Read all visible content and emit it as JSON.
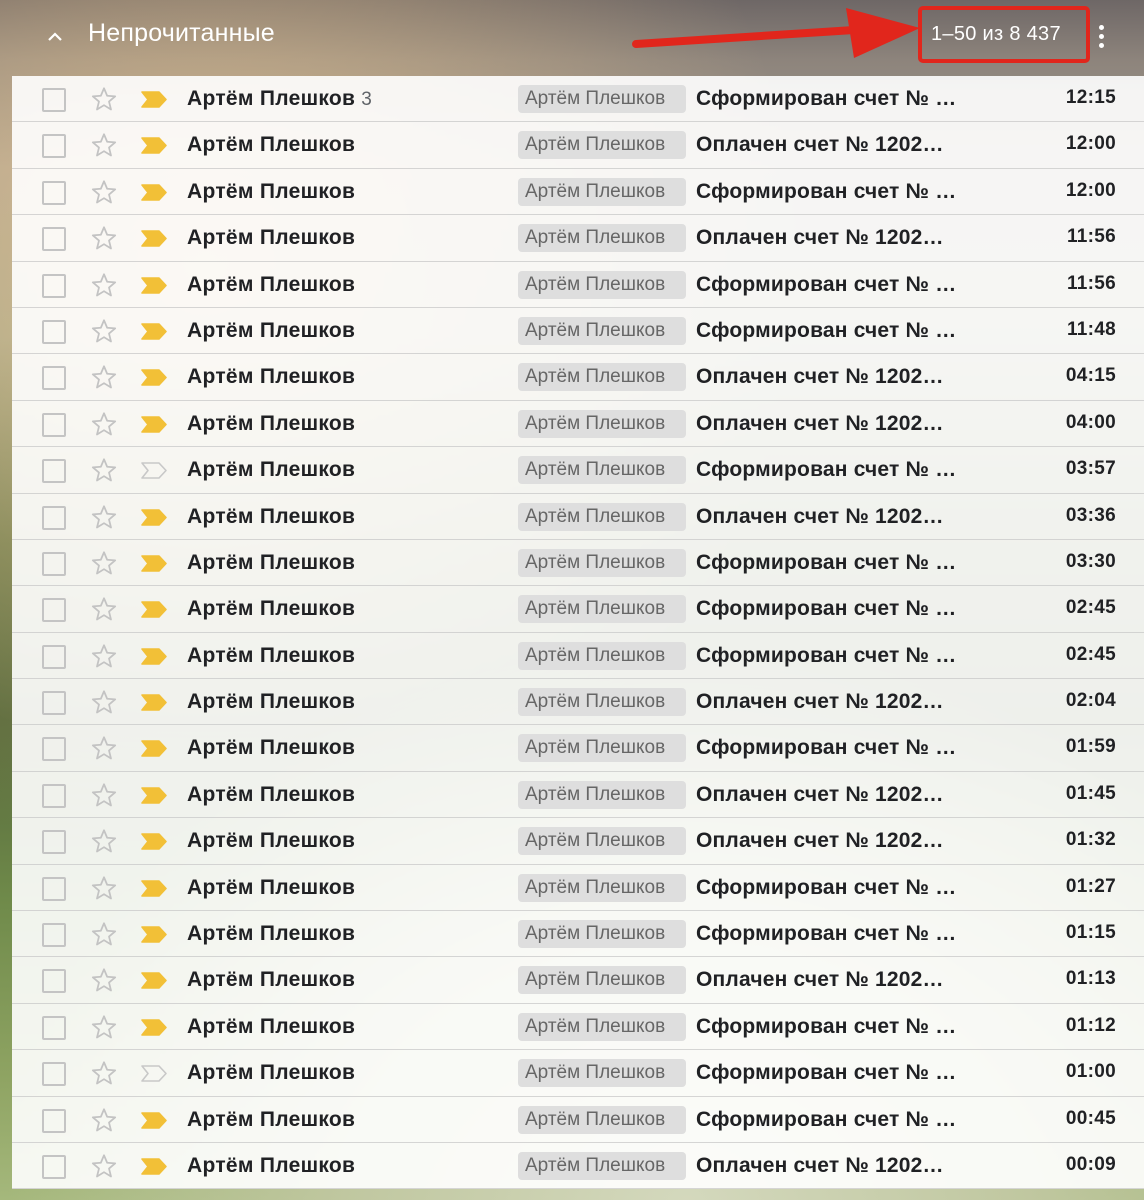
{
  "section": {
    "title": "Непрочитанные",
    "collapse_icon": "chevron-up-icon",
    "more_icon": "more-vert-icon"
  },
  "pagination": {
    "text": "1–50 из 8 437"
  },
  "colors": {
    "highlight": "#e1261c",
    "importance": "#f2c037",
    "importance_outline": "#c8c8c8"
  },
  "rows": [
    {
      "sender": "Артём Плешков",
      "count": "3",
      "label": "Артём Плешков",
      "subject": "Сформирован счет № …",
      "time": "12:15",
      "important": true
    },
    {
      "sender": "Артём Плешков",
      "count": "",
      "label": "Артём Плешков",
      "subject": "Оплачен счет № 1202…",
      "time": "12:00",
      "important": true
    },
    {
      "sender": "Артём Плешков",
      "count": "",
      "label": "Артём Плешков",
      "subject": "Сформирован счет № …",
      "time": "12:00",
      "important": true
    },
    {
      "sender": "Артём Плешков",
      "count": "",
      "label": "Артём Плешков",
      "subject": "Оплачен счет № 1202…",
      "time": "11:56",
      "important": true
    },
    {
      "sender": "Артём Плешков",
      "count": "",
      "label": "Артём Плешков",
      "subject": "Сформирован счет № …",
      "time": "11:56",
      "important": true
    },
    {
      "sender": "Артём Плешков",
      "count": "",
      "label": "Артём Плешков",
      "subject": "Сформирован счет № …",
      "time": "11:48",
      "important": true
    },
    {
      "sender": "Артём Плешков",
      "count": "",
      "label": "Артём Плешков",
      "subject": "Оплачен счет № 1202…",
      "time": "04:15",
      "important": true
    },
    {
      "sender": "Артём Плешков",
      "count": "",
      "label": "Артём Плешков",
      "subject": "Оплачен счет № 1202…",
      "time": "04:00",
      "important": true
    },
    {
      "sender": "Артём Плешков",
      "count": "",
      "label": "Артём Плешков",
      "subject": "Сформирован счет № …",
      "time": "03:57",
      "important": false
    },
    {
      "sender": "Артём Плешков",
      "count": "",
      "label": "Артём Плешков",
      "subject": "Оплачен счет № 1202…",
      "time": "03:36",
      "important": true
    },
    {
      "sender": "Артём Плешков",
      "count": "",
      "label": "Артём Плешков",
      "subject": "Сформирован счет № …",
      "time": "03:30",
      "important": true
    },
    {
      "sender": "Артём Плешков",
      "count": "",
      "label": "Артём Плешков",
      "subject": "Сформирован счет № …",
      "time": "02:45",
      "important": true
    },
    {
      "sender": "Артём Плешков",
      "count": "",
      "label": "Артём Плешков",
      "subject": "Сформирован счет № …",
      "time": "02:45",
      "important": true
    },
    {
      "sender": "Артём Плешков",
      "count": "",
      "label": "Артём Плешков",
      "subject": "Оплачен счет № 1202…",
      "time": "02:04",
      "important": true
    },
    {
      "sender": "Артём Плешков",
      "count": "",
      "label": "Артём Плешков",
      "subject": "Сформирован счет № …",
      "time": "01:59",
      "important": true
    },
    {
      "sender": "Артём Плешков",
      "count": "",
      "label": "Артём Плешков",
      "subject": "Оплачен счет № 1202…",
      "time": "01:45",
      "important": true
    },
    {
      "sender": "Артём Плешков",
      "count": "",
      "label": "Артём Плешков",
      "subject": "Оплачен счет № 1202…",
      "time": "01:32",
      "important": true
    },
    {
      "sender": "Артём Плешков",
      "count": "",
      "label": "Артём Плешков",
      "subject": "Сформирован счет № …",
      "time": "01:27",
      "important": true
    },
    {
      "sender": "Артём Плешков",
      "count": "",
      "label": "Артём Плешков",
      "subject": "Сформирован счет № …",
      "time": "01:15",
      "important": true
    },
    {
      "sender": "Артём Плешков",
      "count": "",
      "label": "Артём Плешков",
      "subject": "Оплачен счет № 1202…",
      "time": "01:13",
      "important": true
    },
    {
      "sender": "Артём Плешков",
      "count": "",
      "label": "Артём Плешков",
      "subject": "Сформирован счет № …",
      "time": "01:12",
      "important": true
    },
    {
      "sender": "Артём Плешков",
      "count": "",
      "label": "Артём Плешков",
      "subject": "Сформирован счет № …",
      "time": "01:00",
      "important": false
    },
    {
      "sender": "Артём Плешков",
      "count": "",
      "label": "Артём Плешков",
      "subject": "Сформирован счет № …",
      "time": "00:45",
      "important": true
    },
    {
      "sender": "Артём Плешков",
      "count": "",
      "label": "Артём Плешков",
      "subject": "Оплачен счет № 1202…",
      "time": "00:09",
      "important": true
    }
  ]
}
